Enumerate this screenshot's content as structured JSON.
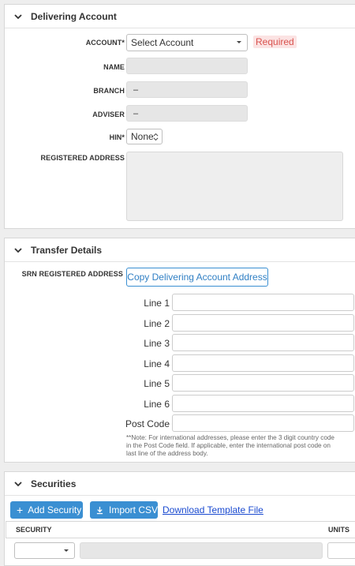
{
  "delivering_account": {
    "title": "Delivering Account",
    "account_label": "ACCOUNT*",
    "account_value": "Select Account",
    "required_text": "Required",
    "name_label": "NAME",
    "name_value": "",
    "branch_label": "BRANCH",
    "branch_value": "–",
    "adviser_label": "ADVISER",
    "adviser_value": "–",
    "hin_label": "HIN*",
    "hin_value": "None",
    "registered_address_label": "REGISTERED ADDRESS"
  },
  "transfer_details": {
    "title": "Transfer Details",
    "srn_label": "SRN REGISTERED ADDRESS",
    "copy_button": "Copy Delivering Account Address",
    "lines": [
      {
        "label": "Line 1",
        "value": ""
      },
      {
        "label": "Line 2",
        "value": ""
      },
      {
        "label": "Line 3",
        "value": ""
      },
      {
        "label": "Line 4",
        "value": ""
      },
      {
        "label": "Line 5",
        "value": ""
      },
      {
        "label": "Line 6",
        "value": ""
      }
    ],
    "post_code_label": "Post Code",
    "note_line1": "**Note: For international addresses, please enter the 3 digit country code",
    "note_line2": "in the Post Code field. If applicable, enter the international post code on",
    "note_line3": "last line of the address body."
  },
  "securities": {
    "title": "Securities",
    "add_button": "Add Security",
    "import_button": "Import CSV",
    "download_link": "Download Template File",
    "columns": [
      "SECURITY",
      "UNITS"
    ]
  },
  "colors": {
    "accent": "#3a8fd2",
    "required_bg": "#fbe3e3",
    "required_text": "#d9534f",
    "link": "#1a4ad0"
  }
}
